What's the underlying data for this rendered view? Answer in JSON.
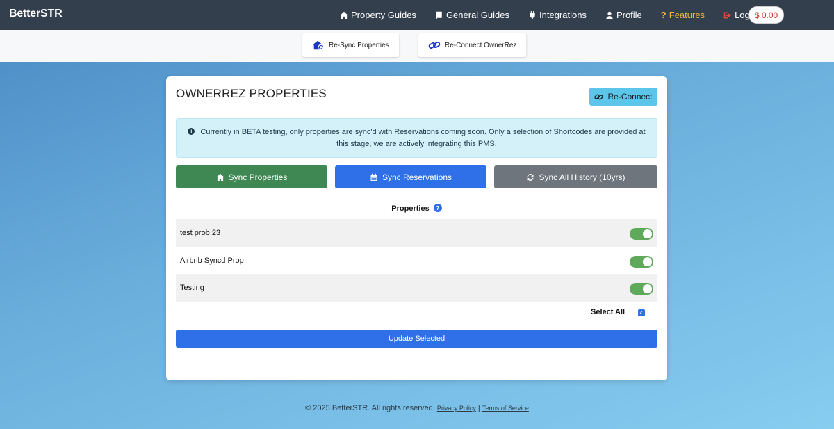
{
  "navbar": {
    "brand": "BetterSTR",
    "links": [
      {
        "label": "Property Guides",
        "icon": "home-icon"
      },
      {
        "label": "General Guides",
        "icon": "book-icon"
      },
      {
        "label": "Integrations",
        "icon": "plug-icon"
      },
      {
        "label": "Profile",
        "icon": "user-icon"
      },
      {
        "label": "Features",
        "icon": "question-icon",
        "color": "#f0b43c"
      },
      {
        "label": "Logout",
        "icon": "logout-icon",
        "icon_color": "#e04a3a"
      }
    ],
    "balance": "$ 0.00"
  },
  "toolbar": {
    "resync_label": "Re-Sync Properties",
    "reconnect_label": "Re-Connect OwnerRez"
  },
  "card": {
    "title": "OWNERREZ PROPERTIES",
    "reconnect_label": "Re-Connect",
    "alert_text": "Currently in BETA testing, only properties are sync'd with Reservations coming soon. Only a selection of Shortcodes are provided at this stage, we are actively integrating this PMS.",
    "buttons": {
      "sync_properties": "Sync Properties",
      "sync_reservations": "Sync Reservations",
      "sync_history": "Sync All History (10yrs)"
    },
    "properties_heading": "Properties",
    "help_glyph": "?",
    "properties": [
      {
        "name": "test prob 23",
        "enabled": true
      },
      {
        "name": "Airbnb Syncd Prop",
        "enabled": true
      },
      {
        "name": "Testing",
        "enabled": true
      }
    ],
    "select_all_label": "Select All",
    "select_all_checked": true,
    "update_label": "Update Selected"
  },
  "footer": {
    "copyright": "© 2025 BetterSTR. All rights reserved.",
    "privacy_label": "Privacy Policy",
    "separator": "|",
    "terms_label": "Terms of Service"
  },
  "colors": {
    "navbar": "#343f4e",
    "green": "#3f8753",
    "blue": "#2f6fe8",
    "gray": "#6f757c",
    "info": "#5bc6ea",
    "toggle_on": "#5ea95a"
  }
}
